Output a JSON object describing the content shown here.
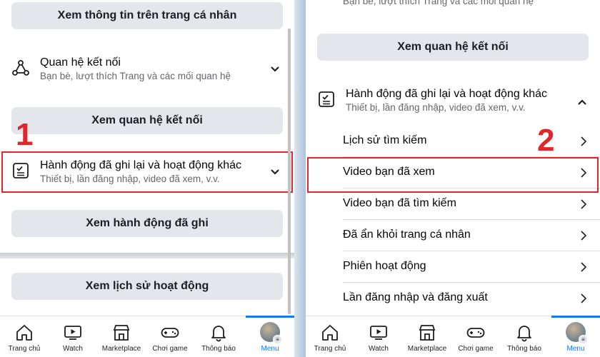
{
  "left": {
    "top_button": "Xem thông tin trên trang cá nhân",
    "connections": {
      "title": "Quan hệ kết nối",
      "subtitle": "Bạn bè, lượt thích Trang và các mối quan hệ"
    },
    "connections_button": "Xem quan hệ kết nối",
    "marker": "1",
    "activity": {
      "title": "Hành động đã ghi lại và hoạt động khác",
      "subtitle": "Thiết bị, lần đăng nhập, video đã xem, v.v."
    },
    "activity_button": "Xem hành động đã ghi",
    "history_button": "Xem lịch sử hoạt động"
  },
  "right": {
    "cut_subtitle": "Bạn bè, lượt thích Trang và các mối quan hệ",
    "connections_button": "Xem quan hệ kết nối",
    "activity": {
      "title": "Hành động đã ghi lại và hoạt động khác",
      "subtitle": "Thiết bị, lần đăng nhập, video đã xem, v.v."
    },
    "marker": "2",
    "items": [
      "Lịch sử tìm kiếm",
      "Video bạn đã xem",
      "Video bạn đã tìm kiếm",
      "Đã ẩn khỏi trang cá nhân",
      "Phiên hoạt động",
      "Lần đăng nhập và đăng xuất"
    ]
  },
  "tabs": [
    "Trang chủ",
    "Watch",
    "Marketplace",
    "Chơi game",
    "Thông báo",
    "Menu"
  ],
  "active_tab": "Menu",
  "colors": {
    "highlight": "#e0262b",
    "accent": "#1877f2",
    "button_bg": "#e4e6eb"
  }
}
